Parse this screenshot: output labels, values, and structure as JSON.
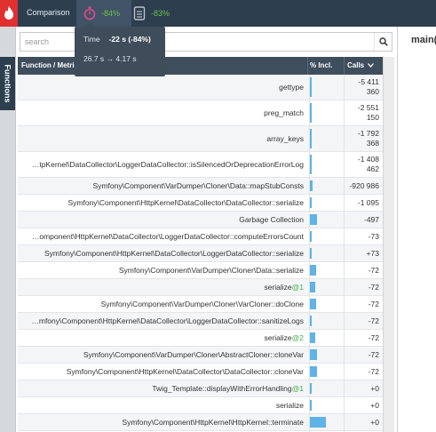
{
  "header": {
    "title": "Comparison",
    "metrics": [
      {
        "name": "time",
        "icon": "stopwatch-icon",
        "value": "-84%"
      },
      {
        "name": "memory",
        "icon": "memory-icon",
        "value": "-83%"
      }
    ],
    "accent_color": "#e0312e",
    "positive_color": "#6cc04a"
  },
  "sidebar": {
    "tab_label": "Functions"
  },
  "search": {
    "placeholder": "search"
  },
  "table": {
    "columns": {
      "function": "Function / Metric",
      "incl": "% Incl.",
      "calls": "Calls"
    },
    "rows": [
      {
        "name": "gettype",
        "suffix": "",
        "calls": [
          "-5 411",
          "360"
        ],
        "incl_pct": 5
      },
      {
        "name": "preg_match",
        "suffix": "",
        "calls": [
          "-2 551",
          "150"
        ],
        "incl_pct": 4
      },
      {
        "name": "array_keys",
        "suffix": "",
        "calls": [
          "-1 792",
          "368"
        ],
        "incl_pct": 2
      },
      {
        "name": "…tpKernel\\DataCollector\\LoggerDataCollector::isSilencedOrDeprecationErrorLog",
        "suffix": "",
        "calls": [
          "-1 408",
          "462"
        ],
        "incl_pct": 4
      },
      {
        "name": "Symfony\\Component\\VarDumper\\Cloner\\Data::mapStubConsts",
        "suffix": "",
        "calls": [
          "-920 986"
        ],
        "incl_pct": 7
      },
      {
        "name": "Symfony\\Component\\HttpKernel\\DataCollector\\DataCollector::serialize",
        "suffix": "",
        "calls": [
          "-1 095"
        ],
        "incl_pct": 4
      },
      {
        "name": "Garbage Collection",
        "suffix": "",
        "calls": [
          "-497"
        ],
        "incl_pct": 22
      },
      {
        "name": "…omponent\\HttpKernel\\DataCollector\\LoggerDataCollector::computeErrorsCount",
        "suffix": "",
        "calls": [
          "-73"
        ],
        "incl_pct": 2
      },
      {
        "name": "Symfony\\Component\\HttpKernel\\DataCollector\\LoggerDataCollector::serialize",
        "suffix": "",
        "calls": [
          "+73"
        ],
        "incl_pct": 2
      },
      {
        "name": "Symfony\\Component\\VarDumper\\Cloner\\Data::serialize",
        "suffix": "",
        "calls": [
          "-72"
        ],
        "incl_pct": 18
      },
      {
        "name": "serialize",
        "suffix": "@1",
        "calls": [
          "-72"
        ],
        "incl_pct": 16
      },
      {
        "name": "Symfony\\Component\\VarDumper\\Cloner\\VarCloner::doClone",
        "suffix": "",
        "calls": [
          "-72"
        ],
        "incl_pct": 18
      },
      {
        "name": "…mfony\\Component\\HttpKernel\\DataCollector\\LoggerDataCollector::sanitizeLogs",
        "suffix": "",
        "calls": [
          "-72"
        ],
        "incl_pct": 2
      },
      {
        "name": "serialize",
        "suffix": "@2",
        "calls": [
          "-72"
        ],
        "incl_pct": 16
      },
      {
        "name": "Symfony\\Component\\VarDumper\\Cloner\\AbstractCloner::cloneVar",
        "suffix": "",
        "calls": [
          "-72"
        ],
        "incl_pct": 20
      },
      {
        "name": "Symfony\\Component\\HttpKernel\\DataCollector\\DataCollector::cloneVar",
        "suffix": "",
        "calls": [
          "-72"
        ],
        "incl_pct": 20
      },
      {
        "name": "Twig_Template::displayWithErrorHandling",
        "suffix": "@1",
        "calls": [
          "+0"
        ],
        "incl_pct": 4
      },
      {
        "name": "serialize",
        "suffix": "",
        "calls": [
          "+0"
        ],
        "incl_pct": 4
      },
      {
        "name": "Symfony\\Component\\HttpKernel\\HttpKernel::terminate",
        "suffix": "",
        "calls": [
          "+0"
        ],
        "incl_pct": 48
      },
      {
        "name": "",
        "suffix": "",
        "calls": [],
        "incl_pct": 12
      }
    ]
  },
  "tooltip": {
    "label": "Time",
    "value": "-22 s (-84%)",
    "detail": "26.7 s → 4.17 s"
  },
  "right_panel": {
    "title": "main("
  }
}
